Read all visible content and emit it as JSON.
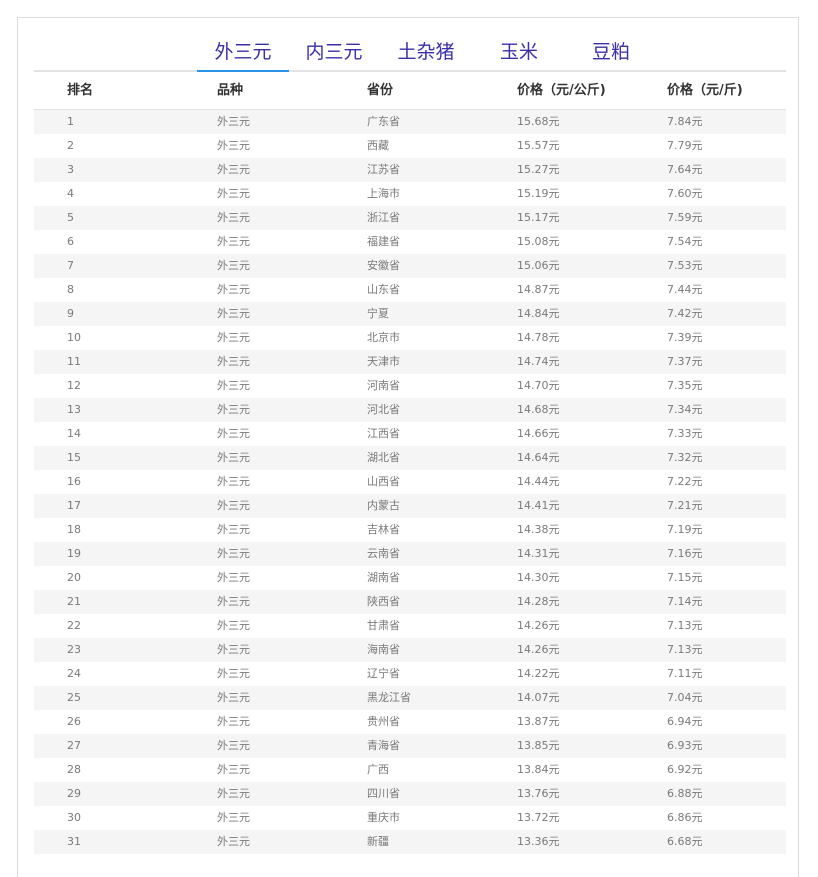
{
  "tabs": [
    "外三元",
    "内三元",
    "土杂猪",
    "玉米",
    "豆粕"
  ],
  "headers": [
    "排名",
    "品种",
    "省份",
    "价格（元/公斤)",
    "价格（元/斤)"
  ],
  "rows": [
    [
      "1",
      "外三元",
      "广东省",
      "15.68元",
      "7.84元"
    ],
    [
      "2",
      "外三元",
      "西藏",
      "15.57元",
      "7.79元"
    ],
    [
      "3",
      "外三元",
      "江苏省",
      "15.27元",
      "7.64元"
    ],
    [
      "4",
      "外三元",
      "上海市",
      "15.19元",
      "7.60元"
    ],
    [
      "5",
      "外三元",
      "浙江省",
      "15.17元",
      "7.59元"
    ],
    [
      "6",
      "外三元",
      "福建省",
      "15.08元",
      "7.54元"
    ],
    [
      "7",
      "外三元",
      "安徽省",
      "15.06元",
      "7.53元"
    ],
    [
      "8",
      "外三元",
      "山东省",
      "14.87元",
      "7.44元"
    ],
    [
      "9",
      "外三元",
      "宁夏",
      "14.84元",
      "7.42元"
    ],
    [
      "10",
      "外三元",
      "北京市",
      "14.78元",
      "7.39元"
    ],
    [
      "11",
      "外三元",
      "天津市",
      "14.74元",
      "7.37元"
    ],
    [
      "12",
      "外三元",
      "河南省",
      "14.70元",
      "7.35元"
    ],
    [
      "13",
      "外三元",
      "河北省",
      "14.68元",
      "7.34元"
    ],
    [
      "14",
      "外三元",
      "江西省",
      "14.66元",
      "7.33元"
    ],
    [
      "15",
      "外三元",
      "湖北省",
      "14.64元",
      "7.32元"
    ],
    [
      "16",
      "外三元",
      "山西省",
      "14.44元",
      "7.22元"
    ],
    [
      "17",
      "外三元",
      "内蒙古",
      "14.41元",
      "7.21元"
    ],
    [
      "18",
      "外三元",
      "吉林省",
      "14.38元",
      "7.19元"
    ],
    [
      "19",
      "外三元",
      "云南省",
      "14.31元",
      "7.16元"
    ],
    [
      "20",
      "外三元",
      "湖南省",
      "14.30元",
      "7.15元"
    ],
    [
      "21",
      "外三元",
      "陕西省",
      "14.28元",
      "7.14元"
    ],
    [
      "22",
      "外三元",
      "甘肃省",
      "14.26元",
      "7.13元"
    ],
    [
      "23",
      "外三元",
      "海南省",
      "14.26元",
      "7.13元"
    ],
    [
      "24",
      "外三元",
      "辽宁省",
      "14.22元",
      "7.11元"
    ],
    [
      "25",
      "外三元",
      "黑龙江省",
      "14.07元",
      "7.04元"
    ],
    [
      "26",
      "外三元",
      "贵州省",
      "13.87元",
      "6.94元"
    ],
    [
      "27",
      "外三元",
      "青海省",
      "13.85元",
      "6.93元"
    ],
    [
      "28",
      "外三元",
      "广西",
      "13.84元",
      "6.92元"
    ],
    [
      "29",
      "外三元",
      "四川省",
      "13.76元",
      "6.88元"
    ],
    [
      "30",
      "外三元",
      "重庆市",
      "13.72元",
      "6.86元"
    ],
    [
      "31",
      "外三元",
      "新疆",
      "13.36元",
      "6.68元"
    ]
  ],
  "colors": {
    "tab_text": "#3a2fa8",
    "tab_active_underline": "#2a93e6",
    "row_alt_bg": "#f5f5f5"
  }
}
